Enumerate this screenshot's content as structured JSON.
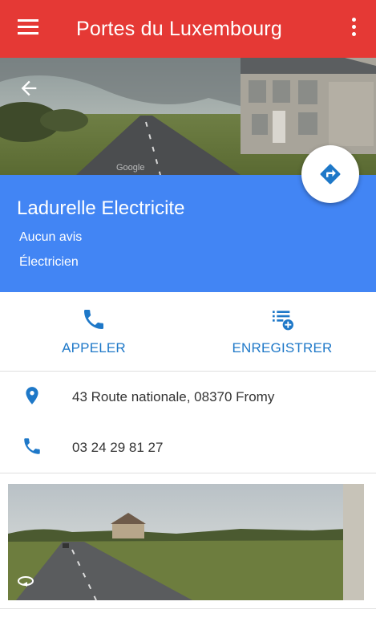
{
  "appbar": {
    "title": "Portes du Luxembourg"
  },
  "place": {
    "name": "Ladurelle Electricite",
    "reviews": "Aucun avis",
    "category": "Électricien"
  },
  "actions": {
    "call_label": "APPELER",
    "save_label": "ENREGISTRER"
  },
  "info": {
    "address": "43 Route nationale, 08370 Fromy",
    "phone": "03 24 29 81 27"
  },
  "colors": {
    "appbar": "#e53935",
    "header": "#4285f4",
    "accent": "#1e78c8"
  },
  "icons": [
    "menu-icon",
    "more-vert-icon",
    "back-arrow-icon",
    "directions-icon",
    "phone-icon",
    "playlist-add-icon",
    "location-pin-icon",
    "phone-icon",
    "360-rotate-icon"
  ]
}
